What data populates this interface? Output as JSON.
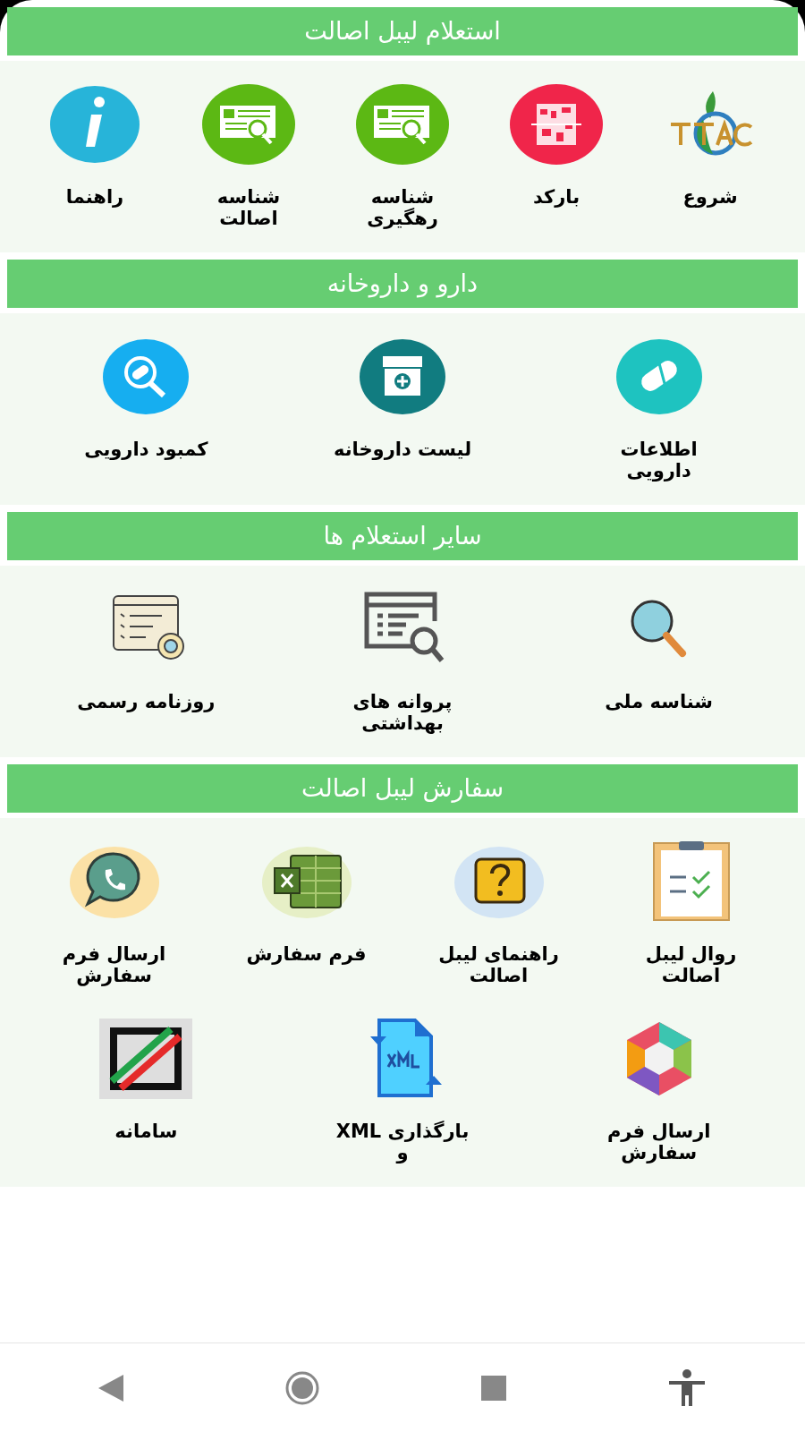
{
  "sections": [
    {
      "title": "استعلام لیبل اصالت",
      "rows": [
        {
          "items": [
            {
              "label": "شروع",
              "kind": "ttac"
            },
            {
              "label": "بارکد",
              "kind": "barcode"
            },
            {
              "label": "شناسه\nرهگیری",
              "kind": "card"
            },
            {
              "label": "شناسه\nاصالت",
              "kind": "card"
            },
            {
              "label": "راهنما",
              "kind": "info"
            }
          ]
        }
      ]
    },
    {
      "title": "دارو و داروخانه",
      "rows": [
        {
          "items": [
            {
              "label": "اطلاعات دارویی",
              "kind": "capsule"
            },
            {
              "label": "لیست داروخانه",
              "kind": "pharmacy"
            },
            {
              "label": "کمبود دارویی",
              "kind": "capsulesearch"
            }
          ]
        }
      ]
    },
    {
      "title": "سایر استعلام ها",
      "rows": [
        {
          "items": [
            {
              "label": "شناسه ملی",
              "kind": "magnifier"
            },
            {
              "label": "پروانه های\nبهداشتی",
              "kind": "formsearch"
            },
            {
              "label": "روزنامه رسمی",
              "kind": "newspaper"
            }
          ]
        }
      ]
    },
    {
      "title": "سفارش لیبل اصالت",
      "rows": [
        {
          "items": [
            {
              "label": "روال لیبل\nاصالت",
              "kind": "clipboard"
            },
            {
              "label": "راهنمای لیبل\nاصالت",
              "kind": "question"
            },
            {
              "label": "فرم سفارش",
              "kind": "sheet"
            },
            {
              "label": "ارسال فرم\nسفارش",
              "kind": "chat"
            }
          ]
        },
        {
          "items": [
            {
              "label": "ارسال فرم سفارش",
              "kind": "cube"
            },
            {
              "label": "بارگذاری XML و",
              "kind": "xml"
            },
            {
              "label": "سامانه",
              "kind": "flag"
            }
          ]
        }
      ]
    }
  ]
}
